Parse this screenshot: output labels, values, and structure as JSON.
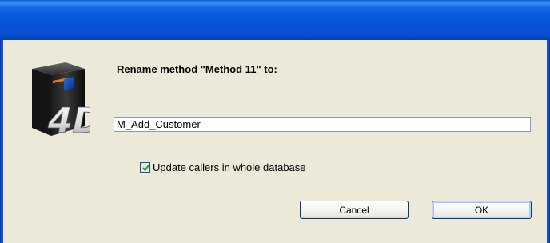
{
  "dialog": {
    "prompt": "Rename method \"Method 11\" to:",
    "input_value": "M_Add_Customer",
    "checkbox": {
      "label": "Update callers in whole database",
      "checked": true
    },
    "buttons": {
      "cancel_label": "Cancel",
      "ok_label": "OK"
    },
    "icon": "4d-app-icon"
  },
  "colors": {
    "titlebar": "#0a5fd8",
    "dialog_bg": "#ece9d8",
    "input_border": "#7f9db9",
    "checkmark": "#21a121"
  }
}
